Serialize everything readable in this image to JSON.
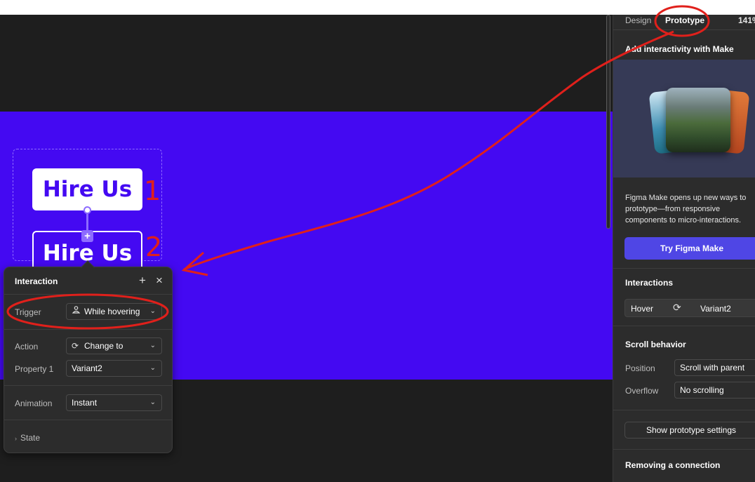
{
  "canvas": {
    "frame_color": "#4409f2",
    "component_1_label": "Hire Us",
    "component_2_label": "Hire Us",
    "add_icon": "+"
  },
  "popover": {
    "title": "Interaction",
    "add_icon": "+",
    "close_icon": "×",
    "trigger_label": "Trigger",
    "trigger_value": "While hovering",
    "action_label": "Action",
    "action_value": "Change to",
    "property_label": "Property 1",
    "property_value": "Variant2",
    "animation_label": "Animation",
    "animation_value": "Instant",
    "state_label": "State"
  },
  "panel": {
    "tab_design": "Design",
    "tab_prototype": "Prototype",
    "zoom": "141%",
    "make_title": "Add interactivity with Make",
    "make_body": "Figma Make opens up new ways to prototype—from responsive components to micro-interactions.",
    "make_button": "Try Figma Make",
    "interactions_title": "Interactions",
    "interaction_trigger": "Hover",
    "interaction_target": "Variant2",
    "scroll_title": "Scroll behavior",
    "position_label": "Position",
    "position_value": "Scroll with parent",
    "overflow_label": "Overflow",
    "overflow_value": "No scrolling",
    "proto_settings_button": "Show prototype settings",
    "removing_title": "Removing a connection"
  },
  "annotations": {
    "number_1": "1",
    "number_2": "2",
    "color": "#e0201b"
  }
}
